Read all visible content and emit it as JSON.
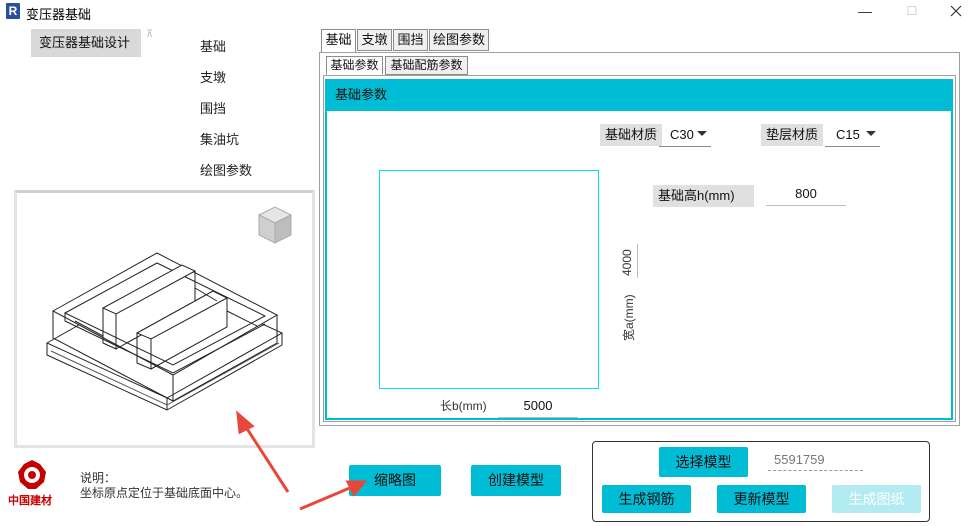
{
  "window": {
    "title": "变压器基础",
    "app_icon_letter": "R",
    "minimize": "—",
    "maximize": "☐"
  },
  "sidebar": {
    "active_item": "变压器基础设计",
    "pin_glyph": "⊼",
    "items": [
      {
        "label": "基础"
      },
      {
        "label": "支墩"
      },
      {
        "label": "围挡"
      },
      {
        "label": "集油坑"
      },
      {
        "label": "绘图参数"
      }
    ]
  },
  "tabs": [
    {
      "label": "基础",
      "active": true
    },
    {
      "label": "支墩",
      "active": false
    },
    {
      "label": "围挡",
      "active": false
    },
    {
      "label": "绘图参数",
      "active": false
    }
  ],
  "subtabs": [
    {
      "label": "基础参数",
      "active": true
    },
    {
      "label": "基础配筋参数",
      "active": false
    }
  ],
  "params": {
    "group_title": "基础参数",
    "material_label": "基础材质",
    "material_value": "C30",
    "cushion_label": "垫层材质",
    "cushion_value": "C15",
    "height_label": "基础高h(mm)",
    "height_value": "800",
    "width_label": "宽a(mm)",
    "width_value": "4000",
    "length_label": "长b(mm)",
    "length_value": "5000"
  },
  "description": {
    "line1": "说明：",
    "line2": "坐标原点定位于基础底面中心。"
  },
  "logo": {
    "text": "中国建材"
  },
  "buttons": {
    "thumbnail": "缩略图",
    "create_model": "创建模型",
    "select_model": "选择模型",
    "model_id": "5591759",
    "gen_rebar": "生成钢筋",
    "update_model": "更新模型",
    "gen_drawing": "生成图纸"
  },
  "colors": {
    "accent": "#00bcd4",
    "accent_disabled": "#b2ebf2",
    "annotation_arrow": "#e8473b"
  }
}
